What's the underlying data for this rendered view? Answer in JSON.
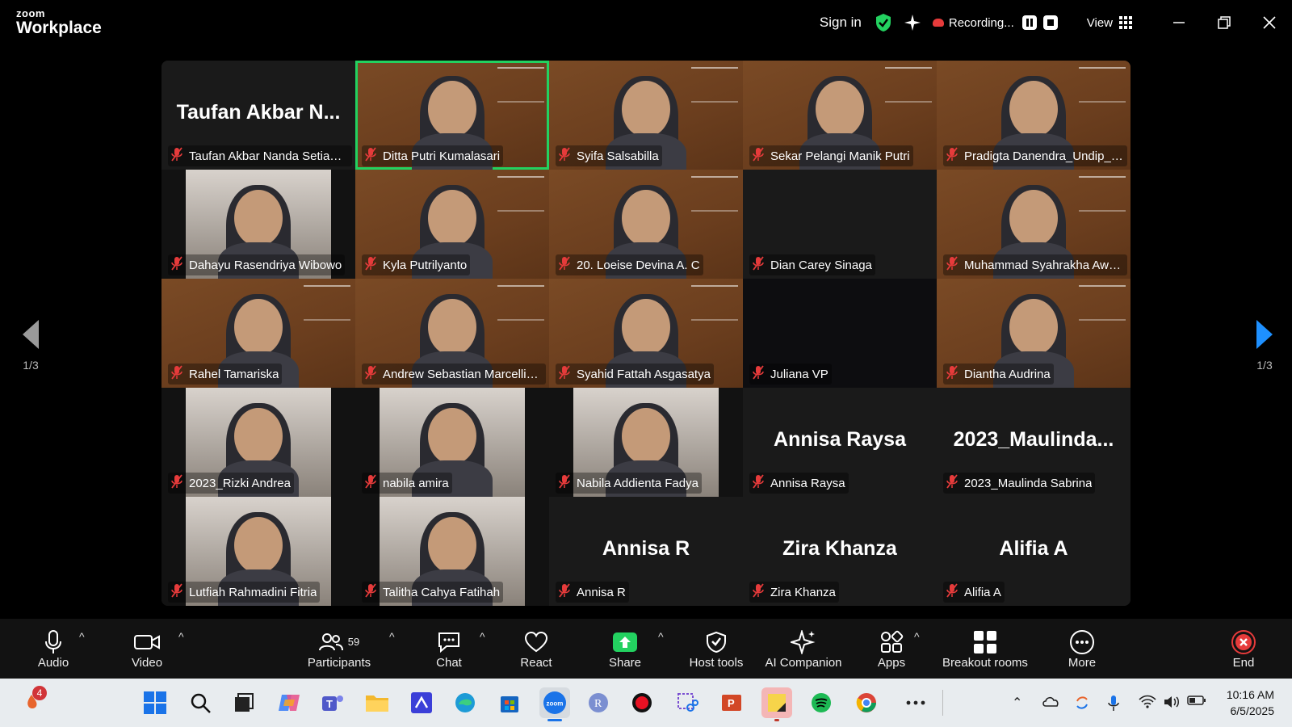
{
  "titlebar": {
    "brand_small": "zoom",
    "brand_big": "Workplace",
    "signin": "Sign in",
    "recording": "Recording...",
    "view": "View"
  },
  "stage": {
    "page_indicator_left": "1/3",
    "page_indicator_right": "1/3"
  },
  "participants": [
    {
      "name": "Taufan Akbar Nanda Setiawan",
      "display": "Taufan Akbar N...",
      "kind": "avatar"
    },
    {
      "name": "Ditta Putri Kumalasari",
      "kind": "video",
      "active": true
    },
    {
      "name": "Syifa Salsabilla",
      "kind": "video"
    },
    {
      "name": "Sekar Pelangi Manik Putri",
      "kind": "video"
    },
    {
      "name": "Pradigta Danendra_Undip_B...",
      "kind": "video"
    },
    {
      "name": "Dahayu Rasendriya Wibowo",
      "kind": "photo"
    },
    {
      "name": "Kyla Putrilyanto",
      "kind": "video"
    },
    {
      "name": "20. Loeise Devina A. C",
      "kind": "video"
    },
    {
      "name": "Dian Carey Sinaga",
      "kind": "blank"
    },
    {
      "name": "Muhammad Syahrakha Awa...",
      "kind": "video"
    },
    {
      "name": "Rahel Tamariska",
      "kind": "video"
    },
    {
      "name": "Andrew Sebastian Marcellin...",
      "kind": "video"
    },
    {
      "name": "Syahid Fattah Asgasatya",
      "kind": "video"
    },
    {
      "name": "Juliana VP",
      "kind": "dark"
    },
    {
      "name": "Diantha Audrina",
      "kind": "video"
    },
    {
      "name": "2023_Rizki Andrea",
      "kind": "photo"
    },
    {
      "name": "nabila amira",
      "kind": "photo"
    },
    {
      "name": "Nabila Addienta Fadya",
      "kind": "photo"
    },
    {
      "name": "Annisa Raysa",
      "display": "Annisa Raysa",
      "kind": "avatar"
    },
    {
      "name": "2023_Maulinda Sabrina",
      "display": "2023_Maulinda...",
      "kind": "avatar"
    },
    {
      "name": "Lutfiah Rahmadini Fitria",
      "kind": "photo"
    },
    {
      "name": "Talitha Cahya Fatihah",
      "kind": "photo"
    },
    {
      "name": "Annisa R",
      "display": "Annisa R",
      "kind": "avatar"
    },
    {
      "name": "Zira Khanza",
      "display": "Zira Khanza",
      "kind": "avatar"
    },
    {
      "name": "Alifia A",
      "display": "Alifia A",
      "kind": "avatar"
    }
  ],
  "toolbar": {
    "audio": "Audio",
    "video": "Video",
    "participants": "Participants",
    "participant_count": "59",
    "chat": "Chat",
    "react": "React",
    "share": "Share",
    "host_tools": "Host tools",
    "ai_companion": "AI Companion",
    "apps": "Apps",
    "breakout_rooms": "Breakout rooms",
    "more": "More",
    "end": "End"
  },
  "taskbar": {
    "notification_badge": "4",
    "time": "10:16 AM",
    "date": "6/5/2025",
    "icons": [
      "weather-icon",
      "windows-start-icon",
      "search-icon",
      "task-view-icon",
      "copilot-icon",
      "teams-icon",
      "file-explorer-icon",
      "visual-studio-icon",
      "edge-icon",
      "microsoft-store-icon",
      "zoom-icon",
      "r-icon",
      "record-icon",
      "snipping-tool-icon",
      "powerpoint-icon",
      "sticky-notes-icon",
      "spotify-icon",
      "chrome-icon",
      "more-apps-icon"
    ]
  },
  "colors": {
    "active_speaker": "#23d160",
    "muted_mic": "#e63b3b",
    "share_green": "#23d160",
    "end_red": "#e63b3b",
    "nav_blue": "#1e90ff"
  }
}
